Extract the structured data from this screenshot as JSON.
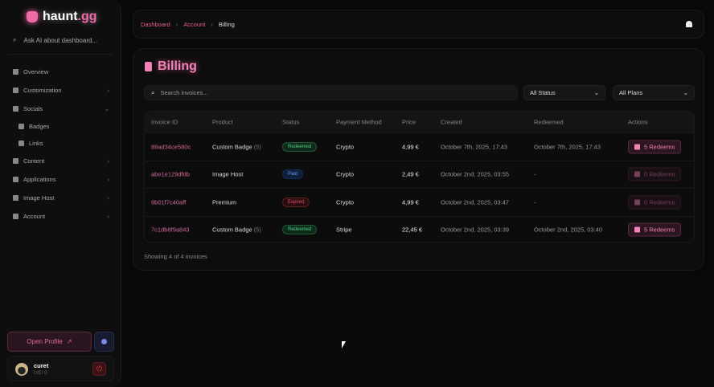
{
  "brand": {
    "name_main": "haunt",
    "name_tld": ".gg"
  },
  "sidebar": {
    "ask_placeholder": "Ask AI about dashboard...",
    "items": [
      {
        "label": "Overview",
        "chevron": ""
      },
      {
        "label": "Customization",
        "chevron": "›"
      },
      {
        "label": "Socials",
        "chevron": "⌄"
      },
      {
        "label": "Badges",
        "sub": true
      },
      {
        "label": "Links",
        "sub": true
      },
      {
        "label": "Content",
        "chevron": "›"
      },
      {
        "label": "Applications",
        "chevron": "›"
      },
      {
        "label": "Image Host",
        "chevron": "›"
      },
      {
        "label": "Account",
        "chevron": "›"
      }
    ],
    "open_profile": "Open Profile",
    "user": {
      "name": "curet",
      "uid": "UID 0"
    }
  },
  "breadcrumb": [
    "Dashboard",
    "Account",
    "Billing"
  ],
  "page": {
    "title": "Billing",
    "search_placeholder": "Search invoices...",
    "status_filter": "All Status",
    "plan_filter": "All Plans",
    "showing": "Showing 4 of 4 invoices"
  },
  "table": {
    "headers": [
      "Invoice ID",
      "Product",
      "Status",
      "Payment Method",
      "Price",
      "Created",
      "Redeemed",
      "Actions"
    ],
    "rows": [
      {
        "id": "88ad34ce580c",
        "product": "Custom Badge",
        "qty": "(5)",
        "status": "Redeemed",
        "method": "Crypto",
        "price": "4,99 €",
        "created": "October 7th, 2025, 17:43",
        "redeemed": "October 7th, 2025, 17:43",
        "action": "5 Redeems"
      },
      {
        "id": "abe1e129dfdb",
        "product": "Image Host",
        "qty": "",
        "status": "Paid",
        "method": "Crypto",
        "price": "2,49 €",
        "created": "October 2nd, 2025, 03:55",
        "redeemed": "-",
        "action": "0 Redeems"
      },
      {
        "id": "9b01f7c40aff",
        "product": "Premium",
        "qty": "",
        "status": "Expired",
        "method": "Crypto",
        "price": "4,99 €",
        "created": "October 2nd, 2025, 03:47",
        "redeemed": "-",
        "action": "0 Redeems"
      },
      {
        "id": "7c1db8f9a843",
        "product": "Custom Badge",
        "qty": "(5)",
        "status": "Redeemed",
        "method": "Stripe",
        "price": "22,45 €",
        "created": "October 2nd, 2025, 03:39",
        "redeemed": "October 2nd, 2025, 03:40",
        "action": "5 Redeems"
      }
    ]
  },
  "colors": {
    "accent": "#f06aa8",
    "redeemed": "#4bd07e",
    "paid": "#6aa0f0",
    "expired": "#e04c56"
  }
}
